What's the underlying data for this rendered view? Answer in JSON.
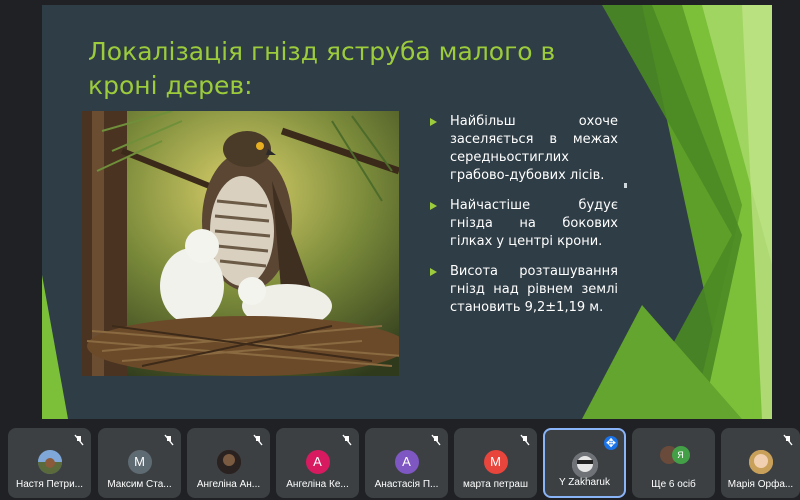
{
  "slide": {
    "title": "Локалізація гнізд яструба малого в кроні дерев:",
    "bullets": [
      "Найбільш охоче заселяється в межах середньостиглих грабово-дубових лісів.",
      "Найчастіше будує гнізда на бокових гілках у центрі крони.",
      "Висота розташування гнізд над рівнем землі становить 9,2±1,19 м."
    ],
    "accent_color": "#9ccc3c",
    "background_color": "#2f3d46"
  },
  "participants": [
    {
      "name": "Настя Петри...",
      "avatar": "photo",
      "muted": true
    },
    {
      "name": "Максим Ста...",
      "avatar": "М",
      "color": "#5f6b73",
      "muted": true
    },
    {
      "name": "Ангеліна Ан...",
      "avatar": "photo",
      "muted": true
    },
    {
      "name": "Ангеліна Ке...",
      "avatar": "А",
      "color": "#d81b60",
      "muted": true
    },
    {
      "name": "Анастасія П...",
      "avatar": "А",
      "color": "#7e57c2",
      "muted": true
    },
    {
      "name": "марта петраш",
      "avatar": "М",
      "color": "#e8453c",
      "muted": true
    },
    {
      "name": "Y Zakharuk",
      "avatar": "photo",
      "muted": false,
      "active": true
    },
    {
      "name": "Ще 6 осіб",
      "avatar": "group",
      "mini_letter": "Я"
    },
    {
      "name": "Марія Орфа...",
      "avatar": "photo",
      "muted": true
    }
  ]
}
